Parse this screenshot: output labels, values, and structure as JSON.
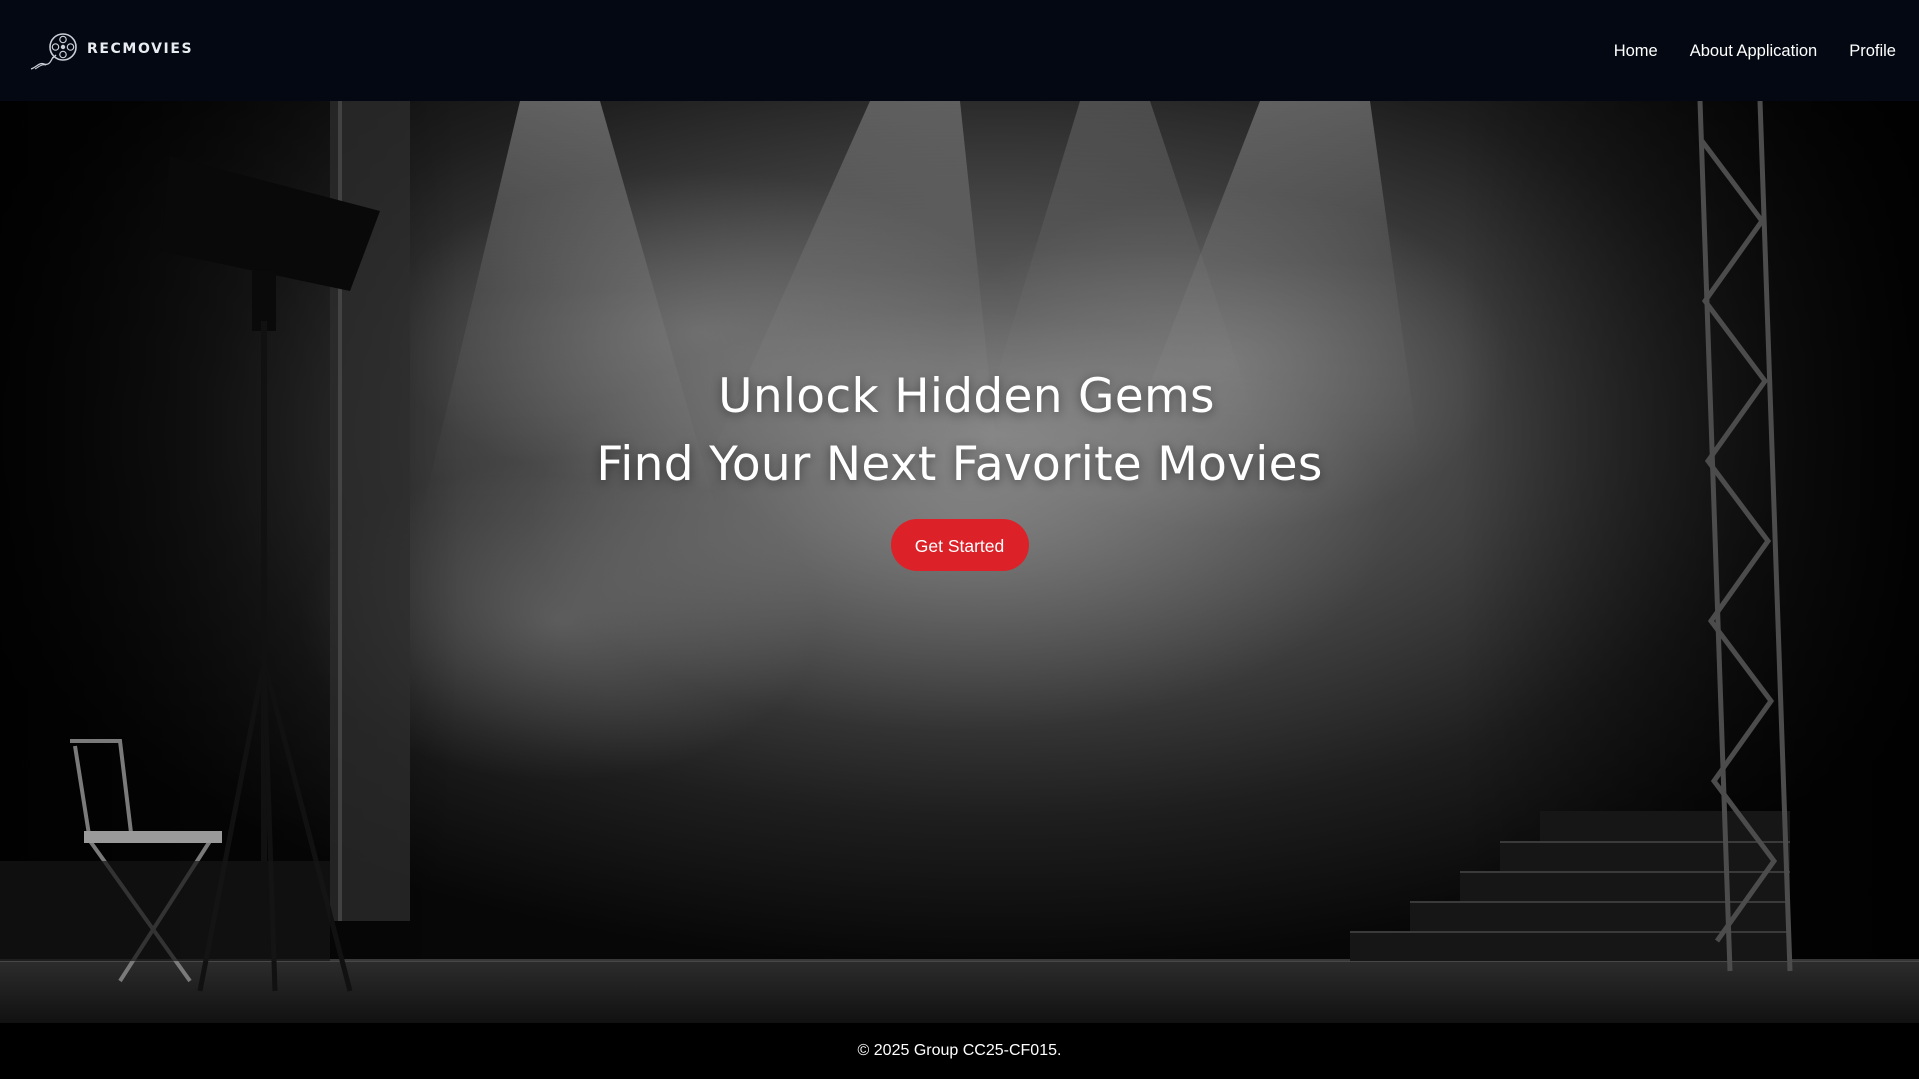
{
  "nav": {
    "brand_name": "RECMOVIES",
    "brand_icon": "film-reel-icon",
    "links": [
      {
        "label": "Home"
      },
      {
        "label": "About Application"
      },
      {
        "label": "Profile"
      }
    ]
  },
  "hero": {
    "title_line_1": "Unlock Hidden Gems",
    "title_line_2": "Find Your Next Favorite Movies",
    "cta_label": "Get Started",
    "background_scene": "dark-theater-stage"
  },
  "footer": {
    "copyright": "© 2025 Group CC25-CF015."
  },
  "colors": {
    "navbar_bg": "#030812",
    "cta_bg": "#dc2228",
    "footer_bg": "#000000",
    "text": "#ffffff"
  }
}
